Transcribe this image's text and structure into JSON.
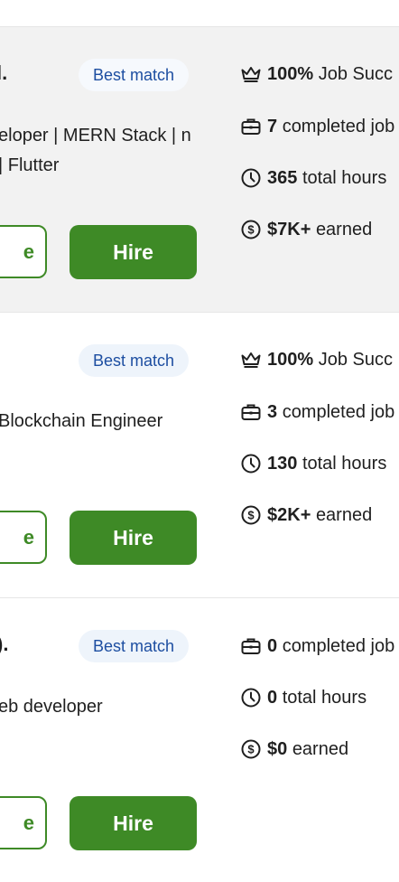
{
  "cards": [
    {
      "name": "l.",
      "badge": "Best match",
      "title": "eloper | MERN Stack | n | Flutter",
      "profile_label": "e",
      "hire_label": "Hire",
      "job_success": {
        "value": "100%",
        "label": "Job Succ"
      },
      "completed_jobs": {
        "value": "7",
        "label": "completed job"
      },
      "total_hours": {
        "value": "365",
        "label": "total hours"
      },
      "earned": {
        "value": "$7K+",
        "label": "earned"
      }
    },
    {
      "name": "",
      "badge": "Best match",
      "title": "Blockchain Engineer",
      "profile_label": "e",
      "hire_label": "Hire",
      "job_success": {
        "value": "100%",
        "label": "Job Succ"
      },
      "completed_jobs": {
        "value": "3",
        "label": "completed job"
      },
      "total_hours": {
        "value": "130",
        "label": "total hours"
      },
      "earned": {
        "value": "$2K+",
        "label": "earned"
      }
    },
    {
      "name": ").",
      "badge": "Best match",
      "title": "eb developer",
      "profile_label": "e",
      "hire_label": "Hire",
      "completed_jobs": {
        "value": "0",
        "label": "completed job"
      },
      "total_hours": {
        "value": "0",
        "label": "total hours"
      },
      "earned": {
        "value": "$0",
        "label": "earned"
      }
    }
  ],
  "icons": {
    "job_success": "crown-icon",
    "completed_jobs": "briefcase-icon",
    "total_hours": "clock-icon",
    "earned": "dollar-circle-icon"
  },
  "colors": {
    "accent_green": "#3e8a26",
    "badge_text": "#1d4ea1",
    "badge_bg": "#eef4fb",
    "highlight_row_bg": "#f2f2f2"
  }
}
